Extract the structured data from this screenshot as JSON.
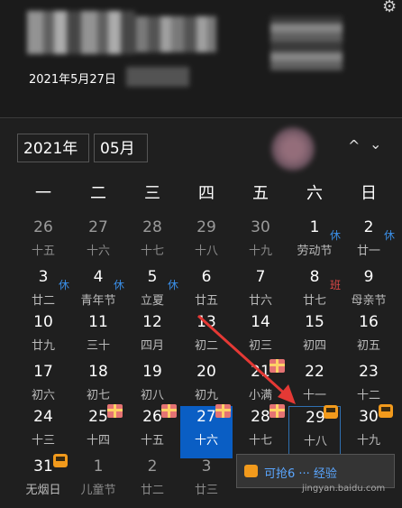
{
  "header": {
    "date_line": "2021年5月27日"
  },
  "controls": {
    "year": "2021年",
    "month": "05月",
    "up": "⌃",
    "down": "⌄"
  },
  "weekdays": [
    "一",
    "二",
    "三",
    "四",
    "五",
    "六",
    "日"
  ],
  "weeks": [
    [
      {
        "n": "26",
        "l": "十五",
        "dim": true
      },
      {
        "n": "27",
        "l": "十六",
        "dim": true
      },
      {
        "n": "28",
        "l": "十七",
        "dim": true
      },
      {
        "n": "29",
        "l": "十八",
        "dim": true
      },
      {
        "n": "30",
        "l": "十九",
        "dim": true
      },
      {
        "n": "1",
        "l": "劳动节",
        "badge": "休"
      },
      {
        "n": "2",
        "l": "廿一",
        "badge": "休"
      }
    ],
    [
      {
        "n": "3",
        "l": "廿二",
        "badge": "休"
      },
      {
        "n": "4",
        "l": "青年节",
        "badge": "休"
      },
      {
        "n": "5",
        "l": "立夏",
        "badge": "休"
      },
      {
        "n": "6",
        "l": "廿五"
      },
      {
        "n": "7",
        "l": "廿六"
      },
      {
        "n": "8",
        "l": "廿七",
        "work": "班"
      },
      {
        "n": "9",
        "l": "母亲节"
      }
    ],
    [
      {
        "n": "10",
        "l": "廿九"
      },
      {
        "n": "11",
        "l": "三十"
      },
      {
        "n": "12",
        "l": "四月"
      },
      {
        "n": "13",
        "l": "初二"
      },
      {
        "n": "14",
        "l": "初三"
      },
      {
        "n": "15",
        "l": "初四"
      },
      {
        "n": "16",
        "l": "初五"
      }
    ],
    [
      {
        "n": "17",
        "l": "初六"
      },
      {
        "n": "18",
        "l": "初七"
      },
      {
        "n": "19",
        "l": "初八"
      },
      {
        "n": "20",
        "l": "初九"
      },
      {
        "n": "21",
        "l": "小满",
        "gift": true
      },
      {
        "n": "22",
        "l": "十一"
      },
      {
        "n": "23",
        "l": "十二"
      }
    ],
    [
      {
        "n": "24",
        "l": "十三"
      },
      {
        "n": "25",
        "l": "十四",
        "gift": true
      },
      {
        "n": "26",
        "l": "十五",
        "gift": true
      },
      {
        "n": "27",
        "l": "十六",
        "gift": true,
        "today": true
      },
      {
        "n": "28",
        "l": "十七",
        "gift": true
      },
      {
        "n": "29",
        "l": "十八",
        "bus": true,
        "outlined": true
      },
      {
        "n": "30",
        "l": "十九",
        "bus": true
      }
    ],
    [
      {
        "n": "31",
        "l": "无烟日",
        "bus": true
      },
      {
        "n": "1",
        "l": "儿童节",
        "dim": true
      },
      {
        "n": "2",
        "l": "廿二",
        "dim": true
      },
      {
        "n": "3",
        "l": "廿三",
        "dim": true
      },
      {
        "n": "",
        "l": ""
      },
      {
        "n": "",
        "l": ""
      },
      {
        "n": "",
        "l": ""
      }
    ]
  ],
  "promo": {
    "text": "可抢6 ···  经验"
  },
  "watermark": "jingyan.baidu.com",
  "colors": {
    "today_bg": "#0a5ec4",
    "rest_badge": "#3a8ee6",
    "work_badge": "#e04848",
    "arrow": "#e53935"
  }
}
